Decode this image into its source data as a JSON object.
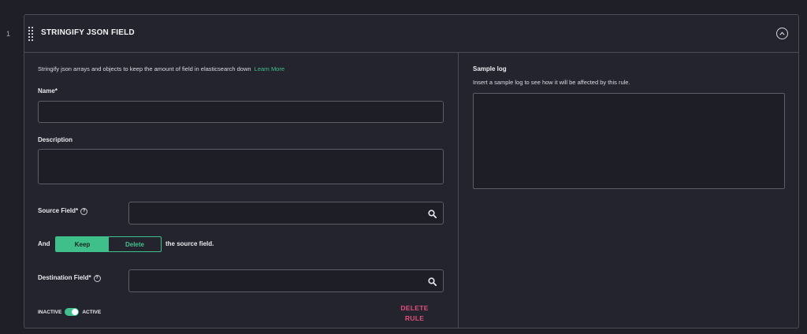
{
  "rule": {
    "index": "1",
    "title": "STRINGIFY JSON FIELD"
  },
  "form": {
    "description_text": "Stringify json arrays and objects to keep the amount of field in elasticsearch down",
    "learn_more": "Learn More",
    "name_label": "Name*",
    "name_value": "",
    "description_label": "Description",
    "description_value": "",
    "source_field_label": "Source Field*",
    "source_field_value": "",
    "and_label": "And",
    "keep_label": "Keep",
    "delete_label": "Delete",
    "source_suffix": "the source field.",
    "selected_action": "Keep",
    "destination_field_label": "Destination Field*",
    "destination_field_value": "",
    "inactive_label": "INACTIVE",
    "active_label": "ACTIVE",
    "active": true,
    "delete_rule_line1": "DELETE",
    "delete_rule_line2": "RULE"
  },
  "sample": {
    "title": "Sample log",
    "description": "Insert a sample log to see how it will be affected by this rule.",
    "value": ""
  },
  "icons": {
    "drag": "drag-handle-icon",
    "collapse": "chevron-up-circle-icon",
    "search": "search-icon",
    "help": "question-circle-icon"
  },
  "colors": {
    "accent": "#3fc08a",
    "danger": "#e04f7a",
    "background": "#1e1f27",
    "panel": "#23242e",
    "border": "#4a4c58"
  }
}
